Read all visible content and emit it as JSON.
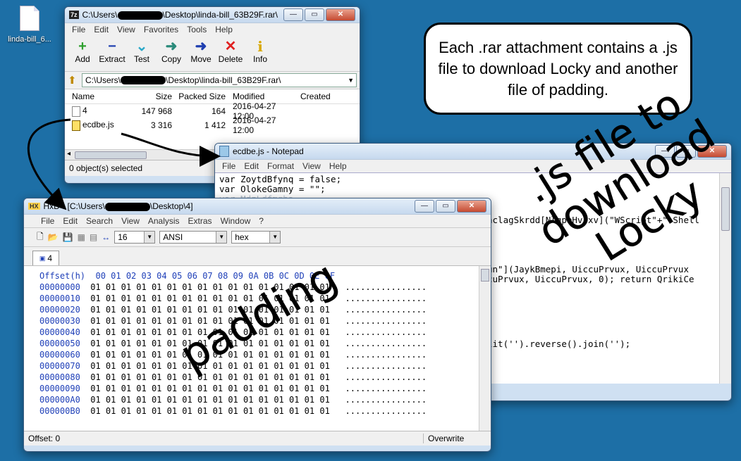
{
  "desktop": {
    "icon_label": "linda-bill_6..."
  },
  "sevenzip": {
    "app_icon": "7z",
    "title_prefix": "C:\\Users\\",
    "title_suffix": "\\Desktop\\linda-bill_63B29F.rar\\",
    "menu": [
      "File",
      "Edit",
      "View",
      "Favorites",
      "Tools",
      "Help"
    ],
    "toolbar": [
      {
        "label": "Add",
        "icon": "plus-icon",
        "glyph": "+",
        "color": "#2ea02e"
      },
      {
        "label": "Extract",
        "icon": "minus-icon",
        "glyph": "−",
        "color": "#1f3fb0"
      },
      {
        "label": "Test",
        "icon": "check-chevron-icon",
        "glyph": "⌄",
        "color": "#2aa8c8"
      },
      {
        "label": "Copy",
        "icon": "arrow-right-icon",
        "glyph": "➜",
        "color": "#2a8a7a"
      },
      {
        "label": "Move",
        "icon": "move-arrow-icon",
        "glyph": "➜",
        "color": "#1f3fb0"
      },
      {
        "label": "Delete",
        "icon": "delete-x-icon",
        "glyph": "✕",
        "color": "#e02020"
      },
      {
        "label": "Info",
        "icon": "info-icon",
        "glyph": "i",
        "color": "#d8a800"
      }
    ],
    "address_prefix": "C:\\Users\\",
    "address_suffix": "\\Desktop\\linda-bill_63B29F.rar\\",
    "columns": [
      "Name",
      "Size",
      "Packed Size",
      "Modified",
      "Created"
    ],
    "rows": [
      {
        "name": "4",
        "size": "147 968",
        "packed": "164",
        "modified": "2016-04-27 12:00",
        "created": ""
      },
      {
        "name": "ecdbe.js",
        "size": "3 316",
        "packed": "1 412",
        "modified": "2016-04-27 12:00",
        "created": ""
      }
    ],
    "status": "0 object(s) selected"
  },
  "notepad": {
    "title": "ecdbe.js - Notepad",
    "menu": [
      "File",
      "Edit",
      "Format",
      "View",
      "Help"
    ],
    "lines": [
      "var ZoytdBfynq = false;",
      "var OlokeGamny = \"\";"
    ],
    "fragments": [
      "hclagSkrdd[NlgpeHvjxv](\"WScript\"+\".Shell",
      "un\"](JaykBmepi, UiccuPrvux, UiccuPrvux",
      "cuPrvux, UiccuPrvux, 0); return QrikiCe",
      "lit('').reverse().join('');"
    ]
  },
  "hxd": {
    "title_prefix": "HxD - [C:\\Users\\",
    "title_suffix": "\\Desktop\\4]",
    "menu": [
      "File",
      "Edit",
      "Search",
      "View",
      "Analysis",
      "Extras",
      "Window",
      "?"
    ],
    "bytes_per_row": "16",
    "charset": "ANSI",
    "display": "hex",
    "tab": "4",
    "header_label": "Offset(h)",
    "header_cols": "00 01 02 03 04 05 06 07 08 09 0A 0B 0C 0D 0E 0F",
    "offsets": [
      "00000000",
      "00000010",
      "00000020",
      "00000030",
      "00000040",
      "00000050",
      "00000060",
      "00000070",
      "00000080",
      "00000090",
      "000000A0",
      "000000B0"
    ],
    "row_bytes": "01 01 01 01 01 01 01 01 01 01 01 01 01 01 01 01",
    "row_text": "................",
    "status_offset": "Offset: 0",
    "status_mode": "Overwrite"
  },
  "callout": {
    "text": "Each .rar attachment contains a .js file to download Locky and another file of padding."
  },
  "annotations": {
    "padding": "padding",
    "js_line1": ".js file to",
    "js_line2": "download",
    "js_line3": "Locky"
  }
}
